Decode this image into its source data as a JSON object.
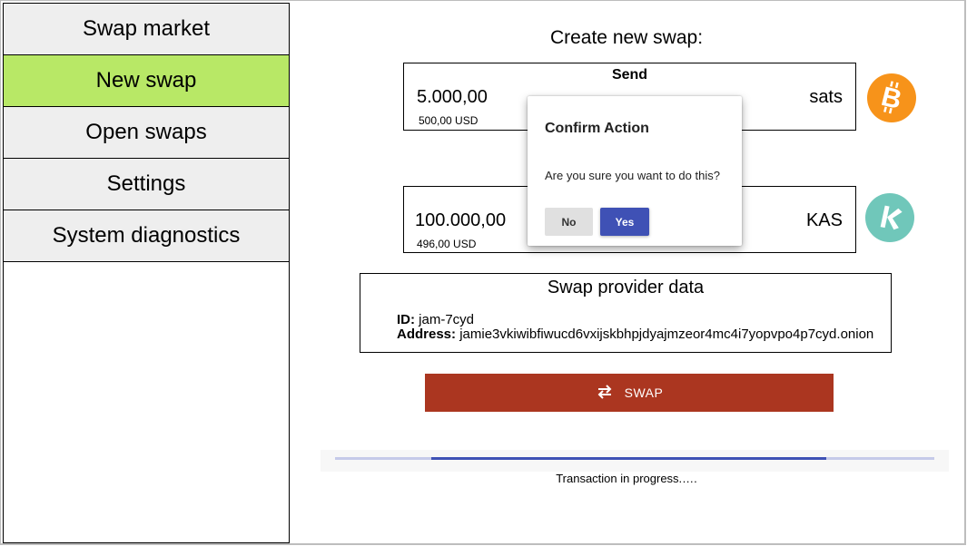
{
  "sidebar": {
    "items": [
      {
        "label": "Swap market",
        "active": false
      },
      {
        "label": "New swap",
        "active": true
      },
      {
        "label": "Open swaps",
        "active": false
      },
      {
        "label": "Settings",
        "active": false
      },
      {
        "label": "System diagnostics",
        "active": false
      }
    ]
  },
  "main": {
    "heading": "Create new swap:",
    "send": {
      "title": "Send",
      "amount": "5.000,00",
      "usd": "500,00 USD",
      "unit": "sats",
      "coin_icon": "bitcoin-icon",
      "coin_color": "#f7931a"
    },
    "receive": {
      "amount": "100.000,00",
      "usd": "496,00 USD",
      "unit": "KAS",
      "coin_icon": "kaspa-icon",
      "coin_color": "#70c7ba"
    },
    "provider": {
      "title": "Swap provider data",
      "id_label": "ID:",
      "id_value": "jam-7cyd",
      "address_label": "Address:",
      "address_value": "jamie3vkiwibfiwucd6vxijskbhpjdyajmzeor4mc4i7yopvpo4p7cyd.onion"
    },
    "swap_button": {
      "label": "SWAP",
      "icon": "swap-arrows-icon",
      "color": "#ab3620"
    },
    "progress": {
      "text": "Transaction in progress.….",
      "start": 0.16,
      "end": 0.82
    }
  },
  "dialog": {
    "title": "Confirm Action",
    "body": "Are you sure you want to do this?",
    "no_label": "No",
    "yes_label": "Yes"
  },
  "colors": {
    "active_nav": "#b8e866",
    "nav_bg": "#eeeeee",
    "primary": "#3f51b5"
  }
}
